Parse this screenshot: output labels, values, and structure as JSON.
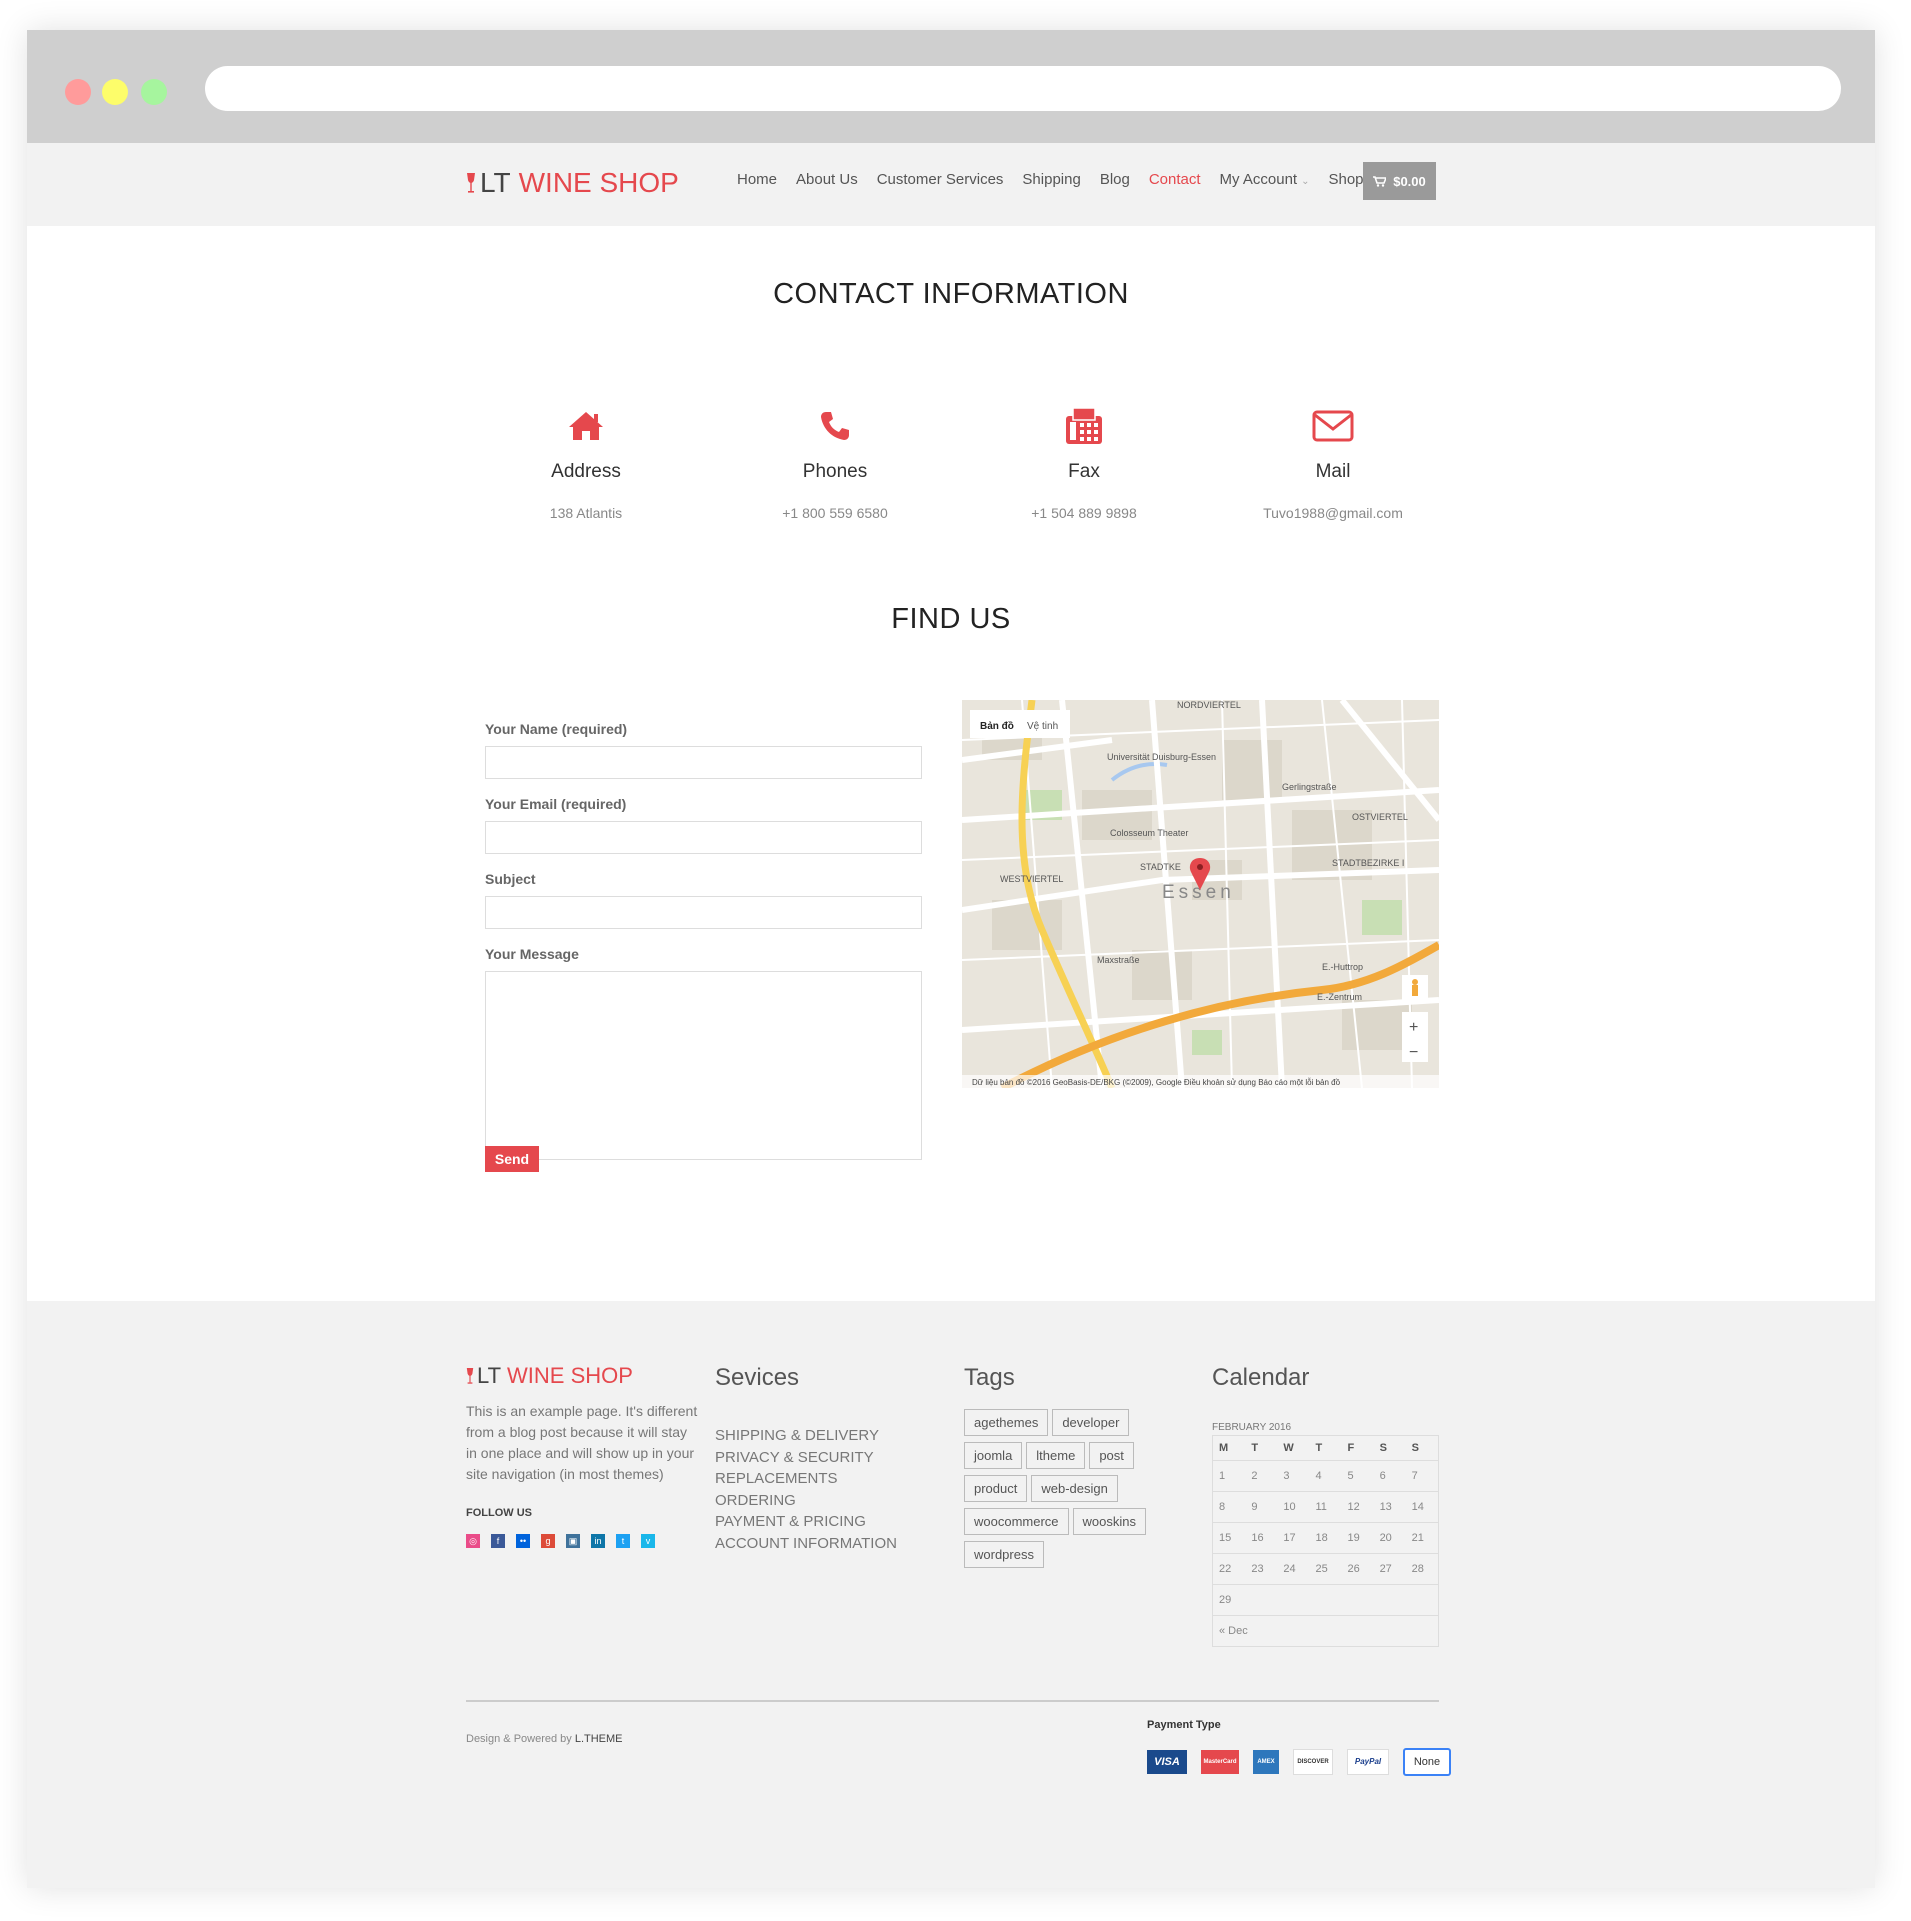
{
  "brand": {
    "prefix": "LT",
    "name": "WINE SHOP"
  },
  "nav": {
    "items": [
      "Home",
      "About Us",
      "Customer Services",
      "Shipping",
      "Blog",
      "Contact",
      "My Account",
      "Shop"
    ],
    "active": "Contact",
    "cart_total": "$0.00"
  },
  "contact": {
    "title": "CONTACT INFORMATION",
    "blocks": [
      {
        "icon": "home-icon",
        "title": "Address",
        "value": "138 Atlantis"
      },
      {
        "icon": "phone-icon",
        "title": "Phones",
        "value": "+1 800 559 6580"
      },
      {
        "icon": "fax-icon",
        "title": "Fax",
        "value": "+1 504 889 9898"
      },
      {
        "icon": "mail-icon",
        "title": "Mail",
        "value": "Tuvo1988@gmail.com"
      }
    ]
  },
  "find_us": {
    "title": "FIND US",
    "form": {
      "name_label": "Your Name (required)",
      "email_label": "Your Email (required)",
      "subject_label": "Subject",
      "message_label": "Your Message",
      "send_label": "Send"
    },
    "map": {
      "tab_map": "Bản đồ",
      "tab_satellite": "Vệ tinh",
      "city": "Essen",
      "labels": [
        "NORDVIERTEL",
        "Universität Duisburg-Essen",
        "Gerlingstraße",
        "OSTVIERTEL",
        "Colosseum Theater",
        "STADTKE",
        "STADTBEZIRKE I",
        "WESTVIERTEL",
        "Maxstraße",
        "E.-Huttrop",
        "E.-Zentrum"
      ],
      "attribution": "Dữ liệu bản đồ ©2016 GeoBasis-DE/BKG (©2009), Google   Điều khoản sử dụng   Báo cáo một lỗi bản đồ",
      "zoom_in": "+",
      "zoom_out": "−"
    }
  },
  "footer": {
    "about_text": "This is an example page. It's different from a blog post because it will stay in one place and will show up in your site navigation (in most themes)",
    "follow_label": "FOLLOW US",
    "services_title": "Sevices",
    "services": [
      "SHIPPING & DELIVERY",
      "PRIVACY & SECURITY",
      "REPLACEMENTS",
      "ORDERING",
      "PAYMENT & PRICING",
      "ACCOUNT INFORMATION"
    ],
    "tags_title": "Tags",
    "tags": [
      "agethemes",
      "developer",
      "joomla",
      "ltheme",
      "post",
      "product",
      "web-design",
      "woocommerce",
      "wooskins",
      "wordpress"
    ],
    "calendar_title": "Calendar",
    "calendar": {
      "caption": "FEBRUARY 2016",
      "days": [
        "M",
        "T",
        "W",
        "T",
        "F",
        "S",
        "S"
      ],
      "weeks": [
        [
          "1",
          "2",
          "3",
          "4",
          "5",
          "6",
          "7"
        ],
        [
          "8",
          "9",
          "10",
          "11",
          "12",
          "13",
          "14"
        ],
        [
          "15",
          "16",
          "17",
          "18",
          "19",
          "20",
          "21"
        ],
        [
          "22",
          "23",
          "24",
          "25",
          "26",
          "27",
          "28"
        ],
        [
          "29",
          "",
          "",
          "",
          "",
          "",
          ""
        ]
      ],
      "prev": "« Dec"
    },
    "credit_prefix": "Design & Powered by",
    "credit_brand": "L.THEME",
    "payment_title": "Payment Type",
    "payment_methods": [
      "VISA",
      "MasterCard",
      "AMEX",
      "DISCOVER",
      "PayPal"
    ],
    "payment_none": "None"
  },
  "colors": {
    "accent": "#e5484d",
    "footer_bg": "#f2f2f2",
    "header_bg": "#f2f2f2"
  }
}
